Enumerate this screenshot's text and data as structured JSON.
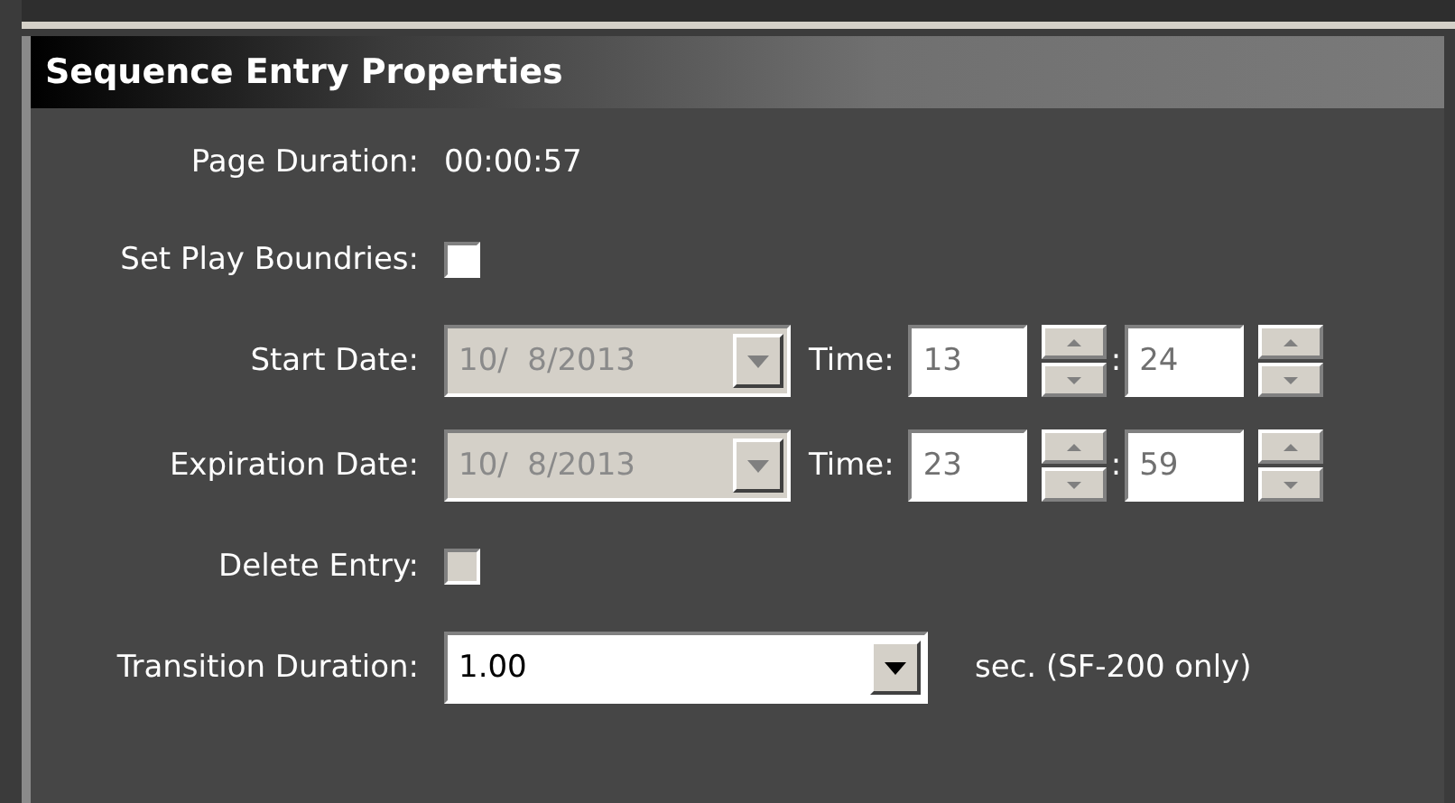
{
  "panel": {
    "title": "Sequence Entry Properties"
  },
  "rows": [
    {
      "kind": "text",
      "label": "Page Duration:",
      "value": "00:00:57"
    },
    {
      "kind": "checkbox",
      "label": "Set Play Boundries:",
      "checked": false,
      "disabled": false
    },
    {
      "kind": "datetime",
      "label": "Start Date:",
      "date": "10/  8/2013",
      "disabled": true,
      "time_label": "Time:",
      "hour": "13",
      "separator": ":",
      "minute": "24"
    },
    {
      "kind": "datetime",
      "label": "Expiration Date:",
      "date": "10/  8/2013",
      "disabled": true,
      "time_label": "Time:",
      "hour": "23",
      "separator": ":",
      "minute": "59"
    },
    {
      "kind": "checkbox",
      "label": "Delete Entry:",
      "checked": false,
      "disabled": true
    },
    {
      "kind": "dropdown",
      "label": "Transition Duration:",
      "value": "1.00",
      "note": "sec. (SF-200 only)"
    }
  ]
}
